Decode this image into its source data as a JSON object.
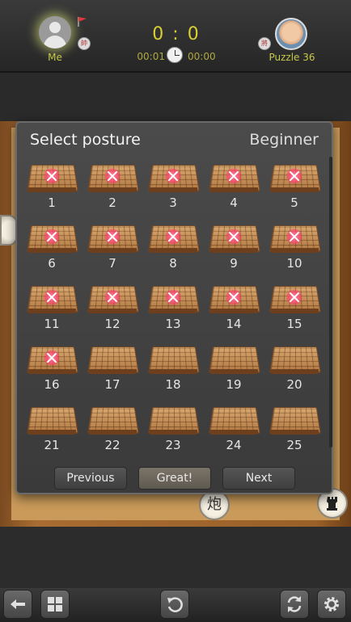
{
  "header": {
    "me_label": "Me",
    "score": "0 : 0",
    "time_left": "00:01",
    "time_right": "00:00",
    "opponent_label": "Puzzle 36",
    "me_side_glyph": "帥",
    "opp_side_glyph": "將"
  },
  "board": {
    "pieces": [
      "炮"
    ]
  },
  "dialog": {
    "title": "Select posture",
    "level": "Beginner",
    "levels": [
      {
        "label": "1",
        "completed": true
      },
      {
        "label": "2",
        "completed": true
      },
      {
        "label": "3",
        "completed": true
      },
      {
        "label": "4",
        "completed": true
      },
      {
        "label": "5",
        "completed": true
      },
      {
        "label": "6",
        "completed": true
      },
      {
        "label": "7",
        "completed": true
      },
      {
        "label": "8",
        "completed": true
      },
      {
        "label": "9",
        "completed": true
      },
      {
        "label": "10",
        "completed": true
      },
      {
        "label": "11",
        "completed": true
      },
      {
        "label": "12",
        "completed": true
      },
      {
        "label": "13",
        "completed": true
      },
      {
        "label": "14",
        "completed": true
      },
      {
        "label": "15",
        "completed": true
      },
      {
        "label": "16",
        "completed": true
      },
      {
        "label": "17",
        "completed": false
      },
      {
        "label": "18",
        "completed": false
      },
      {
        "label": "19",
        "completed": false
      },
      {
        "label": "20",
        "completed": false
      },
      {
        "label": "21",
        "completed": false
      },
      {
        "label": "22",
        "completed": false
      },
      {
        "label": "23",
        "completed": false
      },
      {
        "label": "24",
        "completed": false
      },
      {
        "label": "25",
        "completed": false
      }
    ],
    "buttons": {
      "previous": "Previous",
      "great": "Great!",
      "next": "Next"
    }
  },
  "toolbar": {
    "icons": [
      "back-arrow-icon",
      "grid-menu-icon",
      "undo-icon",
      "refresh-icon",
      "settings-gear-icon"
    ]
  }
}
